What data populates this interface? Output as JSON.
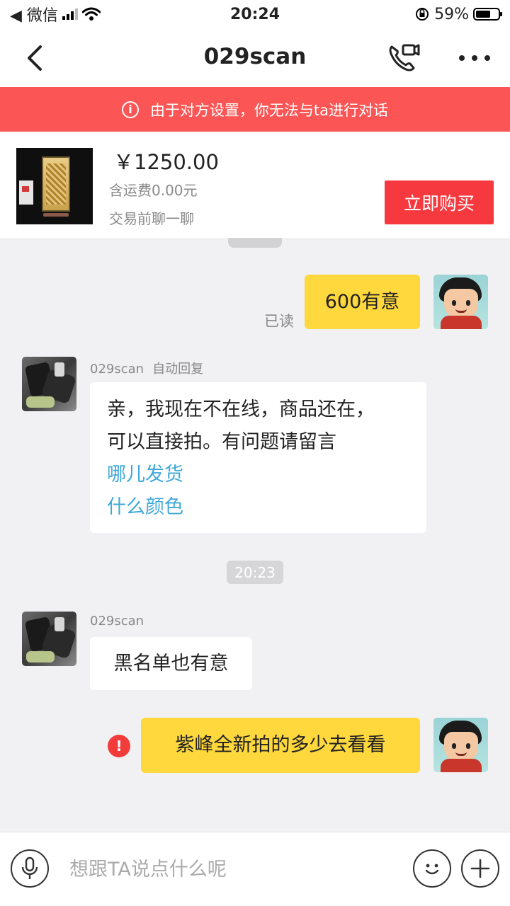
{
  "status_bar": {
    "back_app": "◀ 微信",
    "time": "20:24",
    "battery": "59%"
  },
  "nav": {
    "title": "029scan"
  },
  "banner": {
    "icon": "info-icon",
    "text": "由于对方设置，你无法与ta进行对话"
  },
  "product": {
    "price": "￥1250.00",
    "shipping": "含运费0.00元",
    "chat_hint": "交易前聊一聊",
    "buy_label": "立即购买"
  },
  "messages": {
    "m1": {
      "text": "600有意",
      "status": "已读"
    },
    "m2": {
      "sender": "029scan",
      "tag": "自动回复",
      "line1": "亲，我现在不在线，商品还在，",
      "line2": "可以直接拍。有问题请留言",
      "link1": "哪儿发货",
      "link2": "什么颜色"
    },
    "time_divider": "20:23",
    "m3": {
      "sender": "029scan",
      "text": "黑名单也有意"
    },
    "m4": {
      "text": "紫峰全新拍的多少去看看",
      "error_mark": "!"
    }
  },
  "input": {
    "placeholder": "想跟TA说点什么呢"
  },
  "colors": {
    "banner": "#fb5555",
    "buy_button": "#f6393f",
    "my_bubble": "#ffd83d",
    "link": "#3fa9d8",
    "error": "#f23c3c"
  }
}
